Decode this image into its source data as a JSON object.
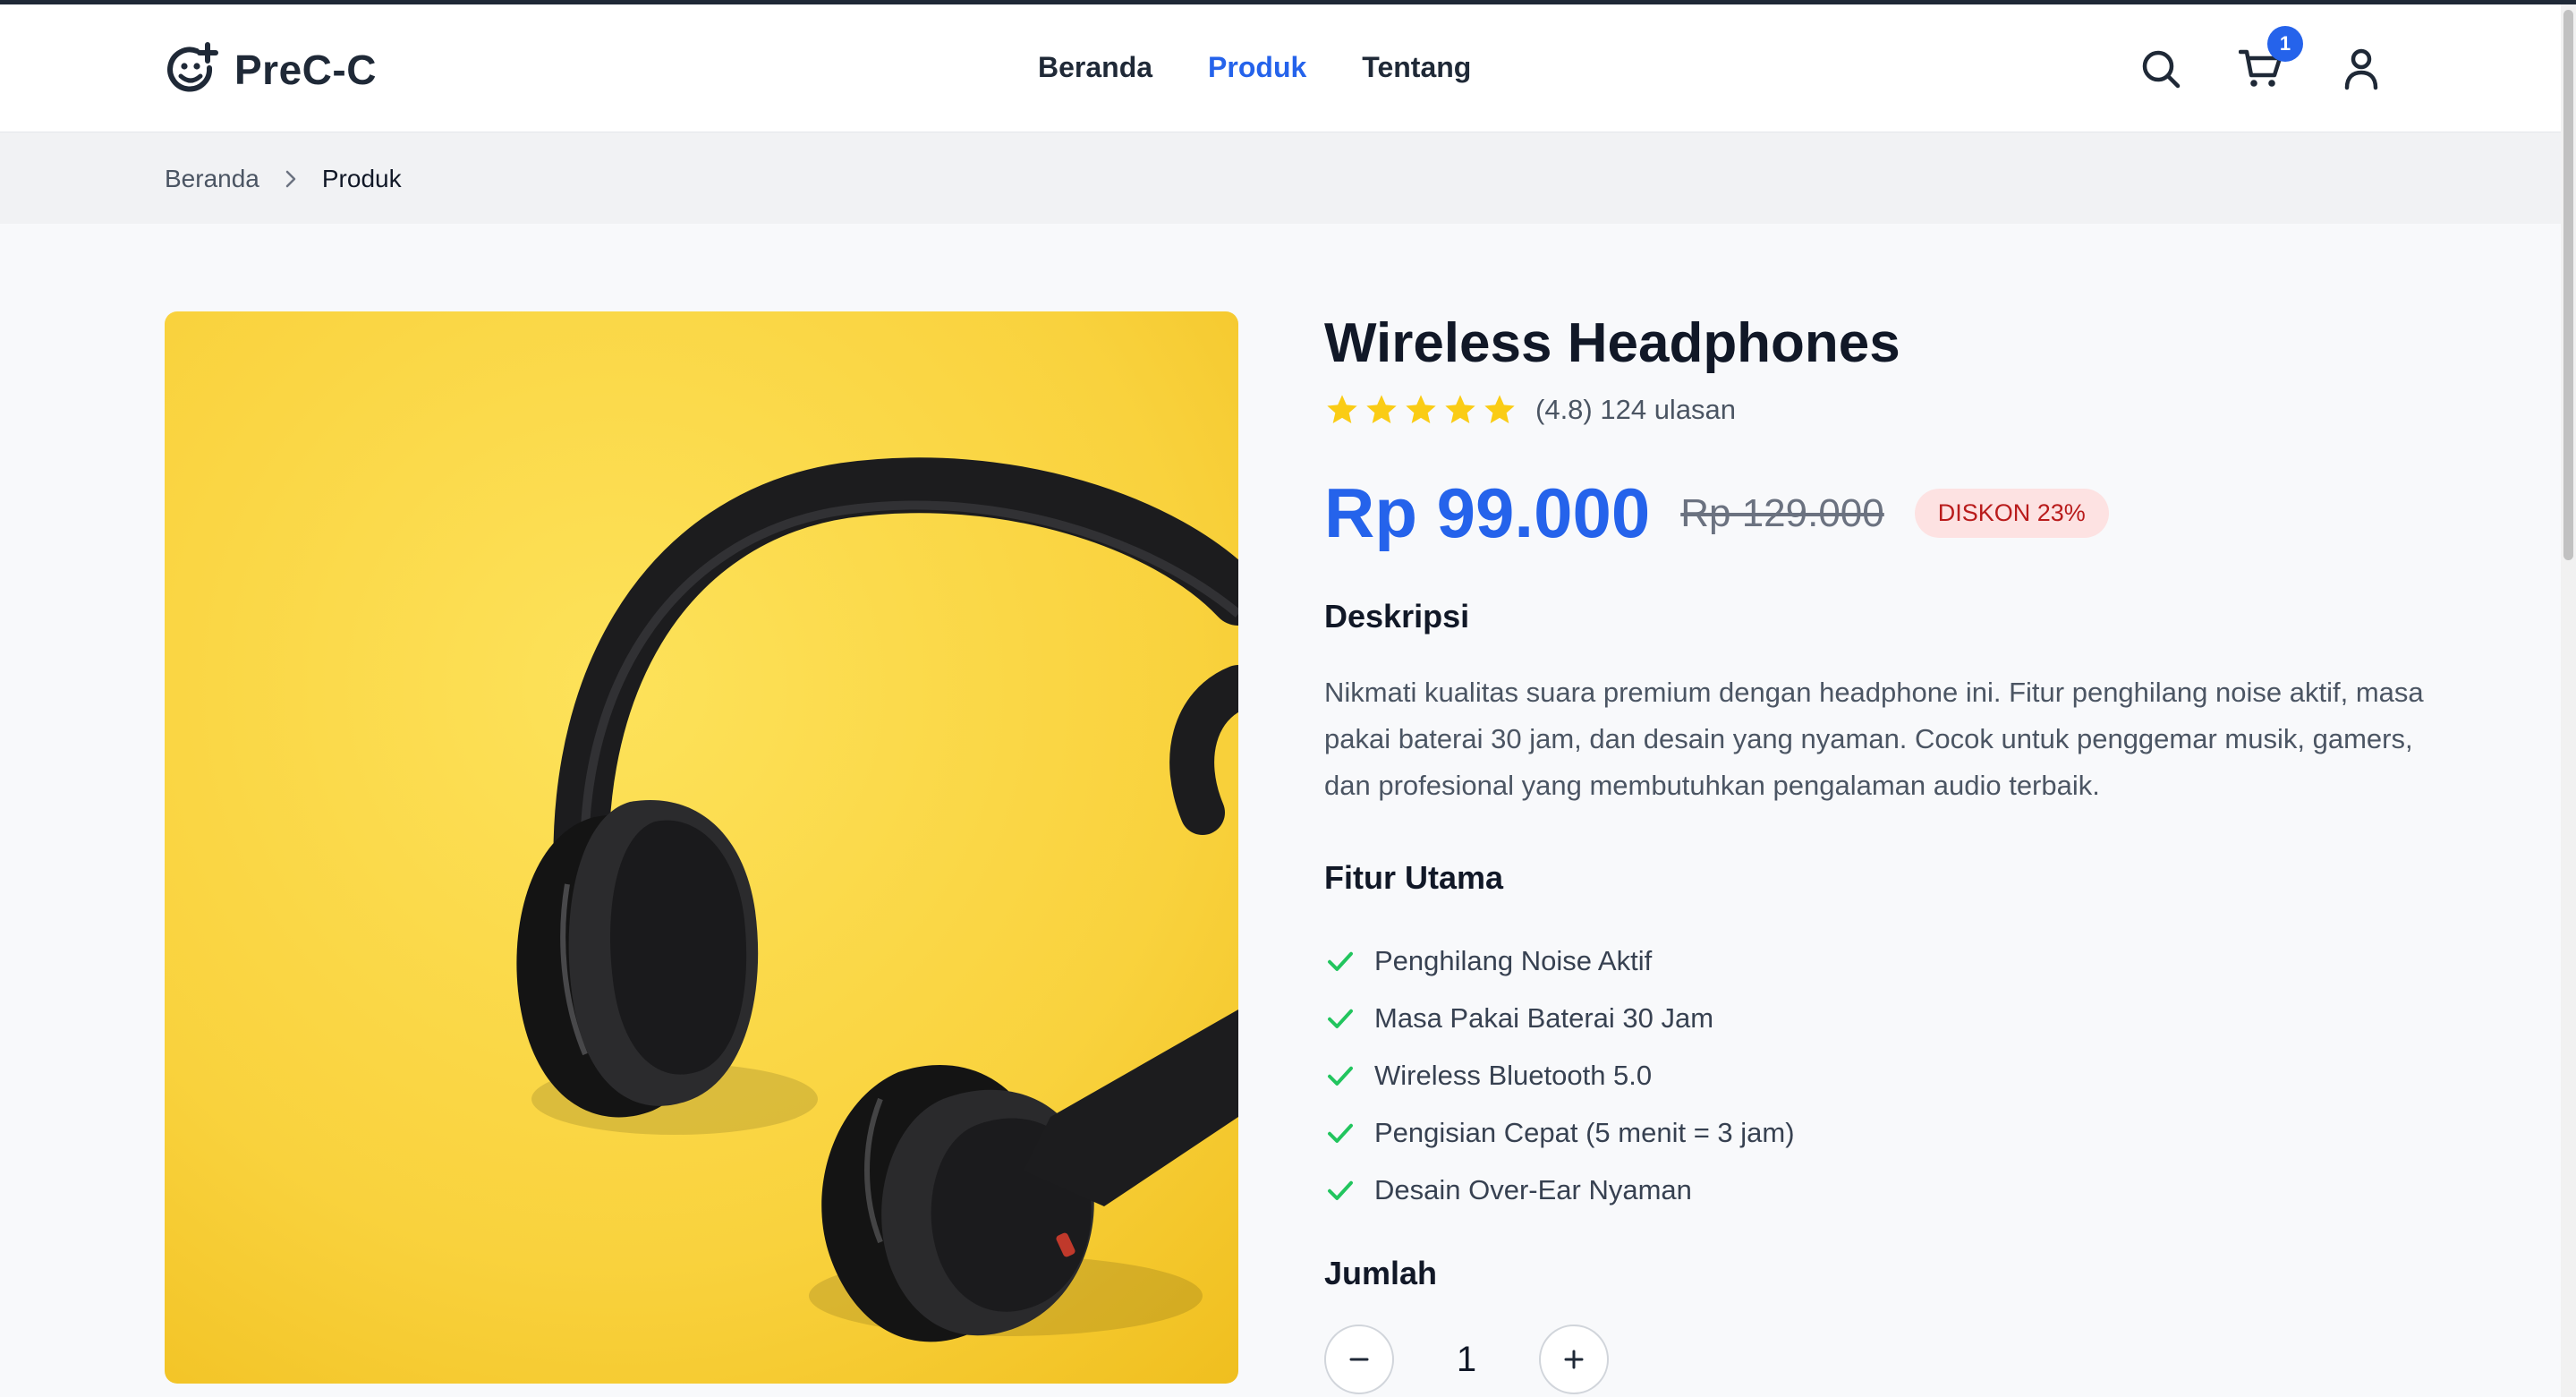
{
  "brand": {
    "name": "PreC-C",
    "logo_icon": "smiley-plus-icon"
  },
  "nav": {
    "items": [
      {
        "label": "Beranda",
        "active": false
      },
      {
        "label": "Produk",
        "active": true
      },
      {
        "label": "Tentang",
        "active": false
      }
    ]
  },
  "header_icons": {
    "search": "search-icon",
    "cart": "cart-icon",
    "cart_count": "1",
    "user": "user-icon"
  },
  "breadcrumb": {
    "home": "Beranda",
    "current": "Produk"
  },
  "product": {
    "title": "Wireless Headphones",
    "rating_value": 4.8,
    "rating_text": "(4.8) 124 ulasan",
    "price": "Rp 99.000",
    "old_price": "Rp 129.000",
    "discount": "DISKON 23%",
    "description_heading": "Deskripsi",
    "description": "Nikmati kualitas suara premium dengan headphone ini. Fitur penghilang noise aktif, masa pakai baterai 30 jam, dan desain yang nyaman. Cocok untuk penggemar musik, gamers, dan profesional yang membutuhkan pengalaman audio terbaik.",
    "features_heading": "Fitur Utama",
    "features": [
      "Penghilang Noise Aktif",
      "Masa Pakai Baterai 30 Jam",
      "Wireless Bluetooth 5.0",
      "Pengisian Cepat (5 menit = 3 jam)",
      "Desain Over-Ear Nyaman"
    ],
    "quantity_heading": "Jumlah",
    "quantity": "1"
  },
  "colors": {
    "accent": "#2563eb",
    "star": "#facc15",
    "check": "#22c55e",
    "image_bg": "#f8d447",
    "discount_bg": "#fde2e2",
    "discount_text": "#b91c1c"
  }
}
